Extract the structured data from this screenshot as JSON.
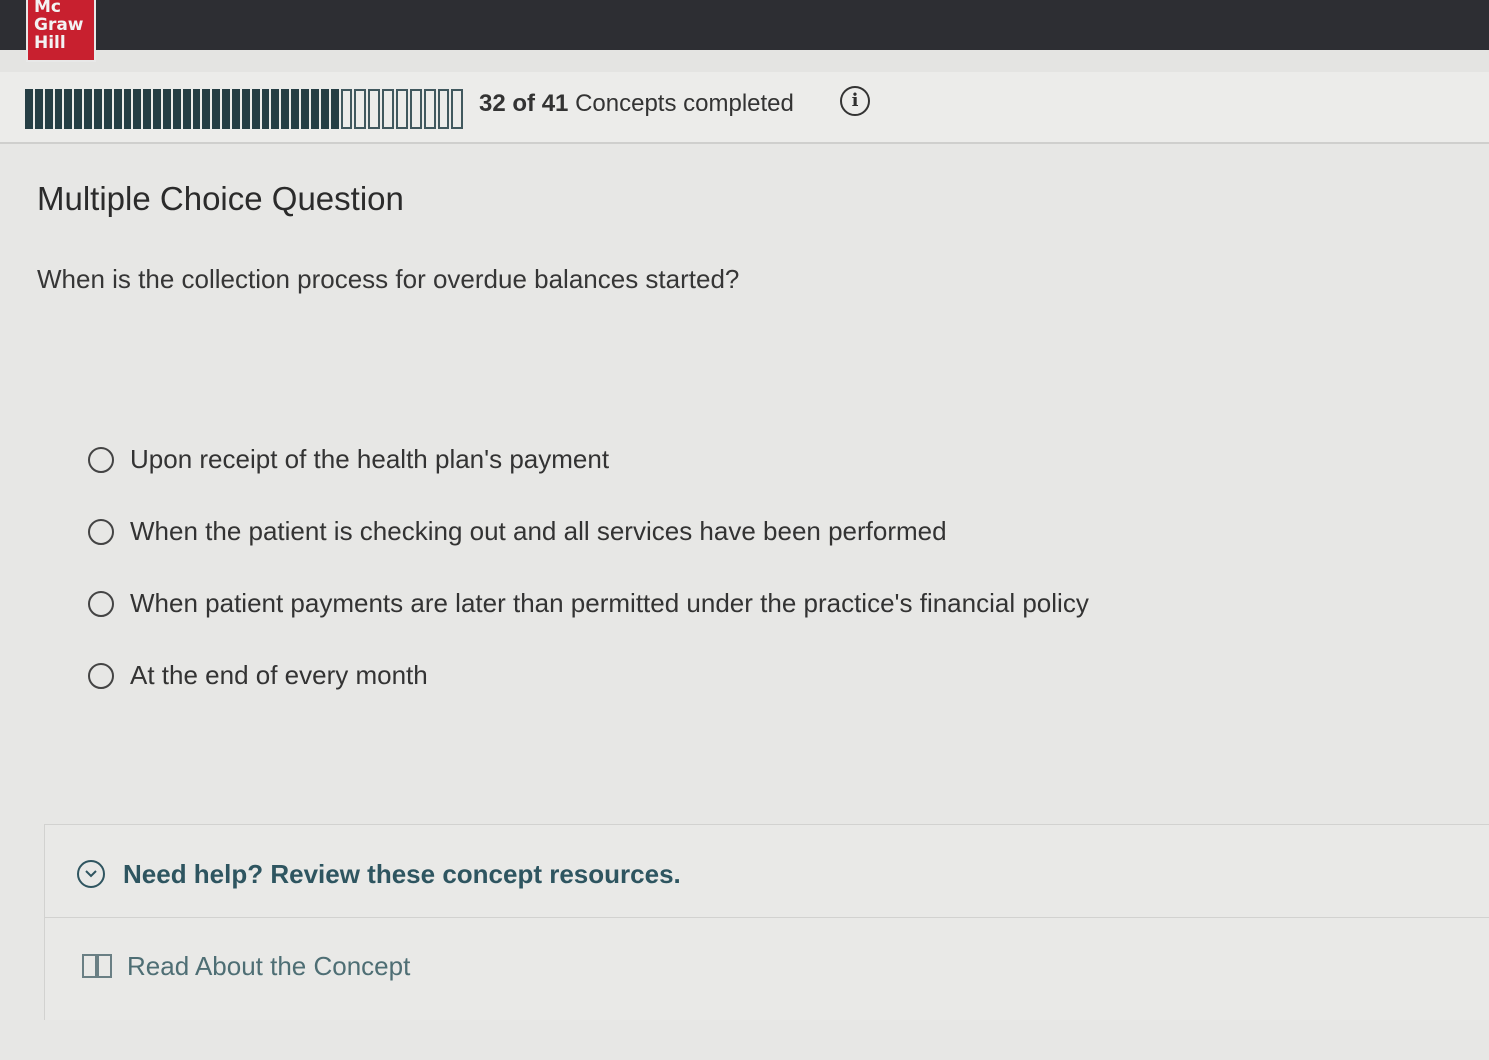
{
  "brand": {
    "logo_lines": [
      "Mc",
      "Graw",
      "Hill"
    ]
  },
  "progress": {
    "completed": 32,
    "total": 41,
    "completed_label": "32",
    "of_label": "of",
    "total_label": "41",
    "suffix": "Concepts completed",
    "info_icon": "info-icon"
  },
  "question": {
    "type_label": "Multiple Choice Question",
    "prompt": "When is the collection process for overdue balances started?",
    "choices": [
      "Upon receipt of the health plan's payment",
      "When the patient is checking out and all services have been performed",
      "When patient payments are later than permitted under the practice's financial policy",
      "At the end of every month"
    ]
  },
  "help": {
    "title": "Need help? Review these concept resources.",
    "icon": "chevron-down-icon",
    "resources": [
      {
        "icon": "book-icon",
        "label": "Read About the Concept"
      }
    ]
  },
  "colors": {
    "topbar": "#2d2e33",
    "logo_red": "#c8202f",
    "progress_fill": "#253e44",
    "help_accent": "#2e5560"
  }
}
